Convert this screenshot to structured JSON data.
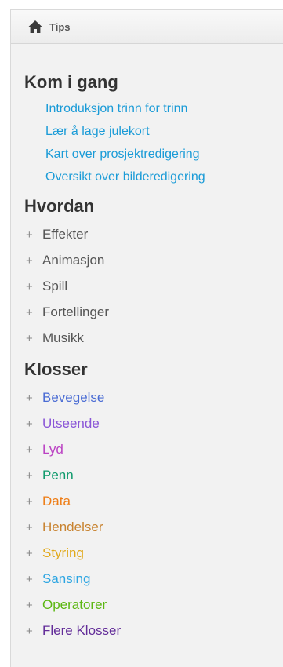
{
  "header": {
    "title": "Tips",
    "icon": "home-icon"
  },
  "getting_started": {
    "title": "Kom i gang",
    "links": [
      {
        "label": "Introduksjon trinn for trinn"
      },
      {
        "label": "Lær å lage julekort"
      },
      {
        "label": "Kart over prosjektredigering"
      },
      {
        "label": "Oversikt over bilderedigering"
      }
    ],
    "link_color": "#1a9bd7"
  },
  "howto": {
    "title": "Hvordan",
    "items": [
      {
        "label": "Effekter"
      },
      {
        "label": "Animasjon"
      },
      {
        "label": "Spill"
      },
      {
        "label": "Fortellinger"
      },
      {
        "label": "Musikk"
      }
    ]
  },
  "blocks": {
    "title": "Klosser",
    "items": [
      {
        "label": "Bevegelse",
        "color": "#4a6cd4"
      },
      {
        "label": "Utseende",
        "color": "#8a55d7"
      },
      {
        "label": "Lyd",
        "color": "#bb42c3"
      },
      {
        "label": "Penn",
        "color": "#0e9a6c"
      },
      {
        "label": "Data",
        "color": "#ee7d16"
      },
      {
        "label": "Hendelser",
        "color": "#c88330"
      },
      {
        "label": "Styring",
        "color": "#e1a91a"
      },
      {
        "label": "Sansing",
        "color": "#2ca5e2"
      },
      {
        "label": "Operatorer",
        "color": "#5cb712"
      },
      {
        "label": "Flere Klosser",
        "color": "#632d99"
      }
    ]
  },
  "expand_symbol": "+"
}
